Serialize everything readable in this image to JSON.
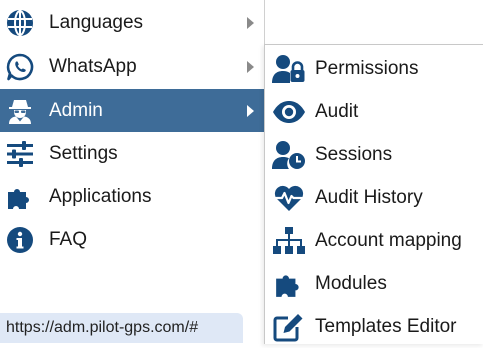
{
  "menu": {
    "items": [
      {
        "label": "Languages",
        "icon": "globe-icon",
        "has_submenu": true
      },
      {
        "label": "WhatsApp",
        "icon": "whatsapp-icon",
        "has_submenu": true
      },
      {
        "label": "Admin",
        "icon": "user-secret-icon",
        "has_submenu": true,
        "active": true
      },
      {
        "label": "Settings",
        "icon": "sliders-icon",
        "has_submenu": false
      },
      {
        "label": "Applications",
        "icon": "puzzle-icon",
        "has_submenu": false
      },
      {
        "label": "FAQ",
        "icon": "info-circle-icon",
        "has_submenu": false
      }
    ]
  },
  "submenu": {
    "items": [
      {
        "label": "Permissions",
        "icon": "user-lock-icon"
      },
      {
        "label": "Audit",
        "icon": "eye-icon"
      },
      {
        "label": "Sessions",
        "icon": "user-clock-icon"
      },
      {
        "label": "Audit History",
        "icon": "heartbeat-icon"
      },
      {
        "label": "Account mapping",
        "icon": "sitemap-icon"
      },
      {
        "label": "Modules",
        "icon": "puzzle-icon"
      },
      {
        "label": "Templates Editor",
        "icon": "edit-icon"
      }
    ]
  },
  "status_bar": {
    "url": "https://adm.pilot-gps.com/#"
  },
  "colors": {
    "icon": "#154a7e",
    "active_bg": "#3e6c98",
    "status_bg": "#dfe8f6"
  }
}
